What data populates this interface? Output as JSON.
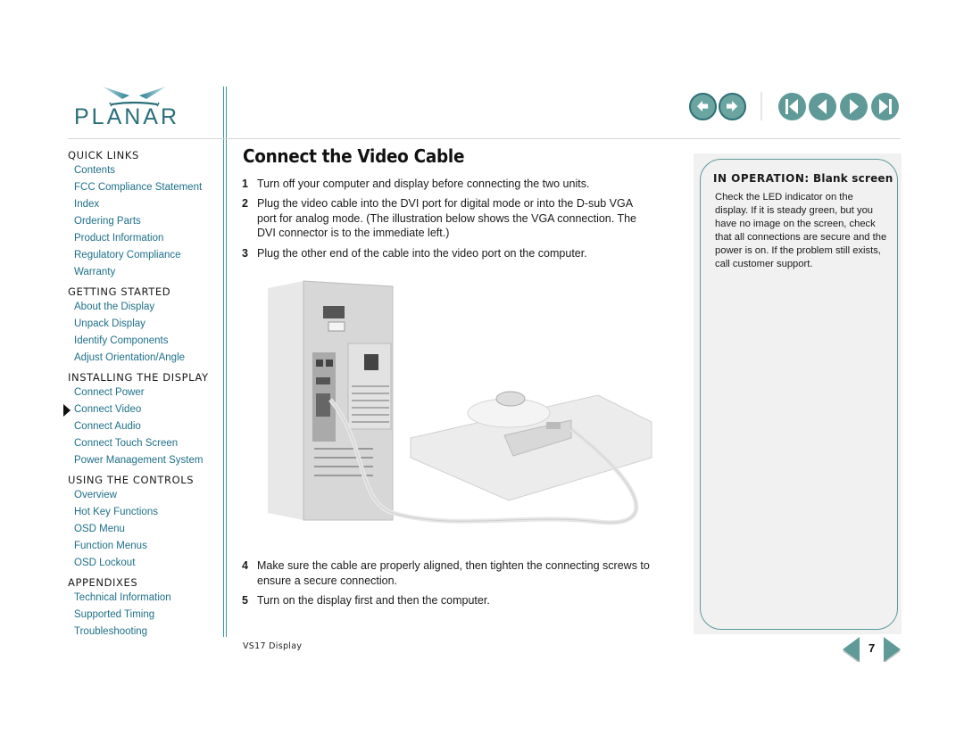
{
  "brand": {
    "name": "PLANAR",
    "accent_color": "#2a6f7a",
    "link_color": "#1d6f8a",
    "nav_button_color": "#5f9a98"
  },
  "toolbar": {
    "buttons": [
      {
        "name": "back",
        "icon": "back-arrow-icon"
      },
      {
        "name": "forward",
        "icon": "forward-arrow-icon"
      },
      {
        "name": "first-page",
        "icon": "first-page-icon"
      },
      {
        "name": "previous-page",
        "icon": "previous-page-icon"
      },
      {
        "name": "next-page",
        "icon": "next-page-icon"
      },
      {
        "name": "last-page",
        "icon": "last-page-icon"
      }
    ]
  },
  "sidebar": {
    "sections": [
      {
        "title": "QUICK LINKS",
        "links": [
          "Contents",
          "FCC Compliance Statement",
          "Index",
          "Ordering Parts",
          "Product Information",
          "Regulatory Compliance",
          "Warranty"
        ]
      },
      {
        "title": "GETTING STARTED",
        "links": [
          "About the Display",
          "Unpack Display",
          "Identify Components",
          "Adjust Orientation/Angle"
        ]
      },
      {
        "title": "INSTALLING THE DISPLAY",
        "links": [
          "Connect Power",
          "Connect Video",
          "Connect Audio",
          "Connect Touch Screen",
          "Power Management System"
        ]
      },
      {
        "title": "USING THE CONTROLS",
        "links": [
          "Overview",
          "Hot Key Functions",
          "OSD Menu",
          "Function Menus",
          "OSD Lockout"
        ]
      },
      {
        "title": "APPENDIXES",
        "links": [
          "Technical Information",
          "Supported Timing",
          "Troubleshooting"
        ]
      }
    ],
    "current": "Connect Video"
  },
  "main": {
    "title": "Connect the Video Cable",
    "steps": [
      {
        "num": "1",
        "text": "Turn off your computer and display before connecting the two units."
      },
      {
        "num": "2",
        "text": "Plug the video cable into the DVI port for digital mode or into the D-sub VGA port for analog mode. (The illustration below shows the VGA connection. The DVI connector is to the immediate left.)"
      },
      {
        "num": "3",
        "text": "Plug the other end of the cable into the video port on the computer."
      },
      {
        "num": "4",
        "text": "Make sure the cable are properly aligned, then tighten the connecting screws to ensure a secure connection."
      },
      {
        "num": "5",
        "text": "Turn on the display first and then the computer."
      }
    ],
    "illustration": "computer-tower-connected-to-display-illustration"
  },
  "sidebox": {
    "title_lead": "IN OPERATION:",
    "title_rest": " Blank screen",
    "body": "Check the LED indicator on the display. If it is steady green, but you have no image on the screen, check that all connections are secure and the power is on. If the problem still exists, call customer support."
  },
  "footer": {
    "doc_name": "VS17 Display",
    "page_number": "7"
  }
}
